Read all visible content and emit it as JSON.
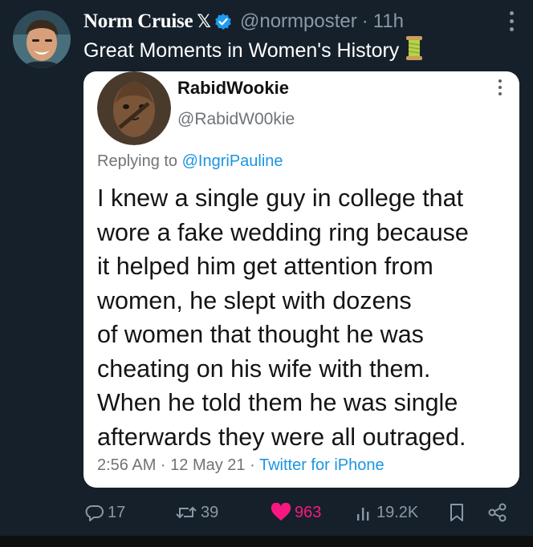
{
  "post": {
    "author_name": "Norm Cruise",
    "x_badge": "𝕏",
    "handle": "@normposter",
    "separator": "·",
    "time": "11h",
    "text": "Great Moments in Women's History",
    "emoji_icon": "thread-spool-icon"
  },
  "embedded": {
    "name": "RabidWookie",
    "handle": "@RabidW00kie",
    "reply_prefix": "Replying to",
    "reply_mention": "@IngriPauline",
    "body_lines": [
      "I knew a single guy in college that",
      "wore a fake wedding ring because",
      "it helped him get attention from",
      "women, he slept with dozens",
      "of women that thought he was",
      "cheating on his wife with them.",
      "When he told them he was single",
      "afterwards they were all outraged."
    ],
    "timestamp": "2:56 AM · 12 May 21 ·",
    "source": "Twitter for iPhone"
  },
  "actions": {
    "replies": "17",
    "reposts": "39",
    "likes": "963",
    "views": "19.2K"
  },
  "colors": {
    "background": "#15202b",
    "like": "#f91880",
    "verified": "#1d9bf0",
    "muted": "#8b98a5",
    "link": "#1b95e0"
  }
}
